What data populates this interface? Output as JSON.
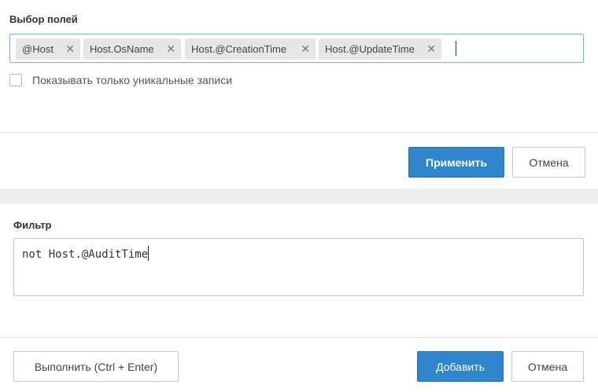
{
  "fields_section": {
    "title": "Выбор полей",
    "tags": [
      {
        "label": "@Host"
      },
      {
        "label": "Host.OsName"
      },
      {
        "label": "Host.@CreationTime"
      },
      {
        "label": "Host.@UpdateTime"
      }
    ],
    "remove_glyph": "✕",
    "unique_checkbox_label": "Показывать только уникальные записи",
    "apply_label": "Применить",
    "cancel_label": "Отмена"
  },
  "filter_section": {
    "title": "Фильтр",
    "query": "not Host.@AuditTime",
    "run_label": "Выполнить (Ctrl + Enter)",
    "add_label": "Добавить",
    "cancel_label": "Отмена"
  },
  "colors": {
    "primary": "#2f86cd",
    "focus_border": "#7fb7e3",
    "tag_background": "#e6e6e6"
  }
}
